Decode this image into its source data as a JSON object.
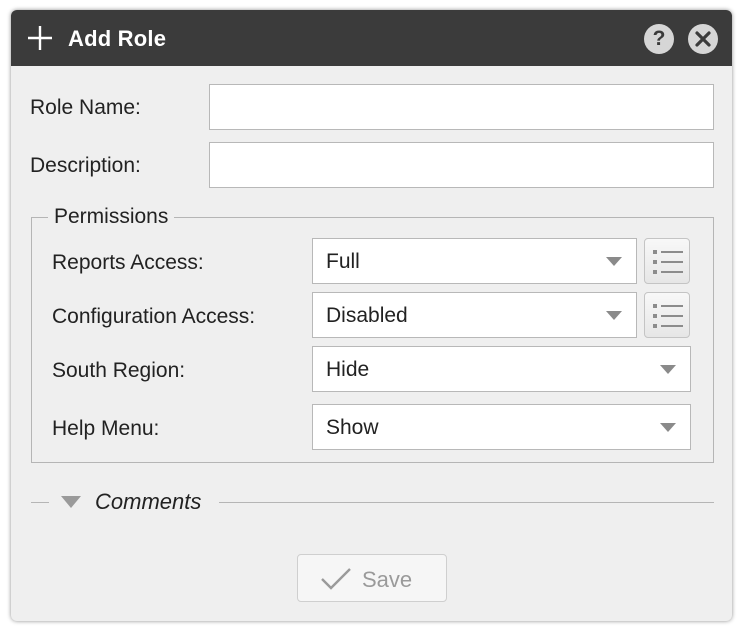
{
  "dialog": {
    "title": "Add Role",
    "help_symbol": "?",
    "icons": {
      "title": "plus-icon",
      "help": "help-icon",
      "close": "close-icon"
    }
  },
  "form": {
    "role_name_label": "Role Name:",
    "role_name_value": "",
    "description_label": "Description:",
    "description_value": ""
  },
  "permissions": {
    "legend": "Permissions",
    "rows": [
      {
        "label": "Reports Access:",
        "value": "Full",
        "has_list_button": true
      },
      {
        "label": "Configuration Access:",
        "value": "Disabled",
        "has_list_button": true
      },
      {
        "label": "South Region:",
        "value": "Hide",
        "has_list_button": false
      },
      {
        "label": "Help Menu:",
        "value": "Show",
        "has_list_button": false
      }
    ]
  },
  "comments": {
    "label": "Comments",
    "collapsed": false
  },
  "footer": {
    "save_label": "Save",
    "save_enabled": false
  },
  "colors": {
    "titlebar": "#3b3b3b",
    "panel": "#efefef",
    "disabled_text": "#9a9a9a"
  }
}
